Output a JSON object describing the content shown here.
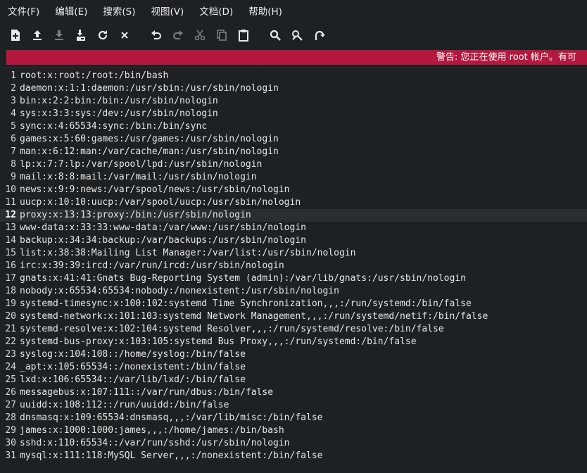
{
  "menubar": {
    "items": [
      "文件(F)",
      "编辑(E)",
      "搜索(S)",
      "视图(V)",
      "文档(D)",
      "帮助(H)"
    ]
  },
  "toolbar": {
    "icons": [
      "new-document-icon",
      "open-icon",
      "save-icon",
      "save-as-icon",
      "reload-icon",
      "close-icon",
      "undo-icon",
      "redo-icon",
      "cut-icon",
      "copy-icon",
      "paste-icon",
      "find-icon",
      "tools-icon",
      "jump-icon"
    ]
  },
  "warning": {
    "text": "警告: 您正在使用 root 帐户。有可"
  },
  "editor": {
    "current_line": 12,
    "lines": [
      "root:x:root:/root:/bin/bash",
      "daemon:x:1:1:daemon:/usr/sbin:/usr/sbin/nologin",
      "bin:x:2:2:bin:/bin:/usr/sbin/nologin",
      "sys:x:3:3:sys:/dev:/usr/sbin/nologin",
      "sync:x:4:65534:sync:/bin:/bin/sync",
      "games:x:5:60:games:/usr/games:/usr/sbin/nologin",
      "man:x:6:12:man:/var/cache/man:/usr/sbin/nologin",
      "lp:x:7:7:lp:/var/spool/lpd:/usr/sbin/nologin",
      "mail:x:8:8:mail:/var/mail:/usr/sbin/nologin",
      "news:x:9:9:news:/var/spool/news:/usr/sbin/nologin",
      "uucp:x:10:10:uucp:/var/spool/uucp:/usr/sbin/nologin",
      "proxy:x:13:13:proxy:/bin:/usr/sbin/nologin",
      "www-data:x:33:33:www-data:/var/www:/usr/sbin/nologin",
      "backup:x:34:34:backup:/var/backups:/usr/sbin/nologin",
      "list:x:38:38:Mailing List Manager:/var/list:/usr/sbin/nologin",
      "irc:x:39:39:ircd:/var/run/ircd:/usr/sbin/nologin",
      "gnats:x:41:41:Gnats Bug-Reporting System (admin):/var/lib/gnats:/usr/sbin/nologin",
      "nobody:x:65534:65534:nobody:/nonexistent:/usr/sbin/nologin",
      "systemd-timesync:x:100:102:systemd Time Synchronization,,,:/run/systemd:/bin/false",
      "systemd-network:x:101:103:systemd Network Management,,,:/run/systemd/netif:/bin/false",
      "systemd-resolve:x:102:104:systemd Resolver,,,:/run/systemd/resolve:/bin/false",
      "systemd-bus-proxy:x:103:105:systemd Bus Proxy,,,:/run/systemd:/bin/false",
      "syslog:x:104:108::/home/syslog:/bin/false",
      "_apt:x:105:65534::/nonexistent:/bin/false",
      "lxd:x:106:65534::/var/lib/lxd/:/bin/false",
      "messagebus:x:107:111::/var/run/dbus:/bin/false",
      "uuidd:x:108:112::/run/uuidd:/bin/false",
      "dnsmasq:x:109:65534:dnsmasq,,,:/var/lib/misc:/bin/false",
      "james:x:1000:1000:james,,,:/home/james:/bin/bash",
      "sshd:x:110:65534::/var/run/sshd:/usr/sbin/nologin",
      "mysql:x:111:118:MySQL Server,,,:/nonexistent:/bin/false"
    ]
  }
}
